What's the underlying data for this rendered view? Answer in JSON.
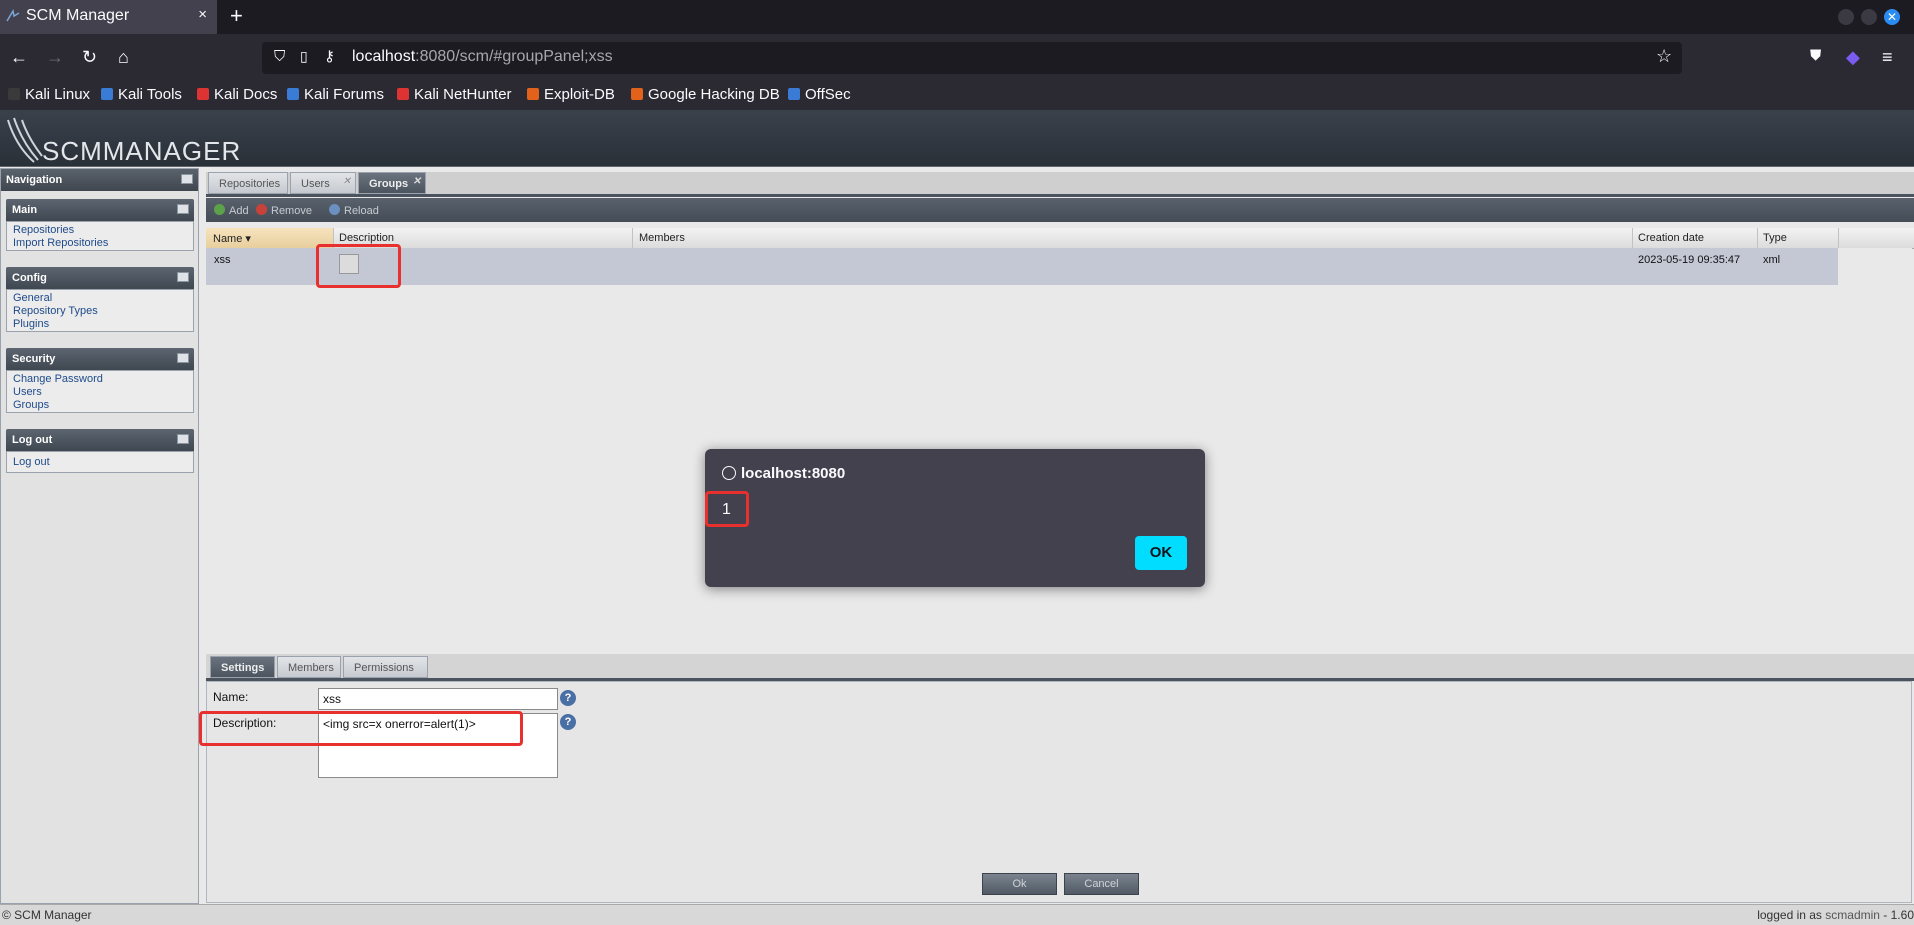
{
  "browser": {
    "tab_title": "SCM Manager",
    "tab_close": "×",
    "new_tab": "+",
    "url_host": "localhost",
    "url_rest": ":8080/scm/#groupPanel;xss",
    "bookmarks": [
      "Kali Linux",
      "Kali Tools",
      "Kali Docs",
      "Kali Forums",
      "Kali NetHunter",
      "Exploit-DB",
      "Google Hacking DB",
      "OffSec"
    ]
  },
  "app": {
    "logo": "SCMMANAGER",
    "nav_title": "Navigation",
    "panels": [
      {
        "title": "Main",
        "links": [
          "Repositories",
          "Import Repositories"
        ]
      },
      {
        "title": "Config",
        "links": [
          "General",
          "Repository Types",
          "Plugins"
        ]
      },
      {
        "title": "Security",
        "links": [
          "Change Password",
          "Users",
          "Groups"
        ]
      },
      {
        "title": "Log out",
        "links": [
          "Log out"
        ]
      }
    ],
    "tabs": [
      "Repositories",
      "Users",
      "Groups"
    ],
    "toolbar": {
      "add": "Add",
      "remove": "Remove",
      "reload": "Reload"
    },
    "grid": {
      "columns": [
        "Name",
        "Description",
        "Members",
        "Creation date",
        "Type"
      ],
      "rows": [
        {
          "name": "xss",
          "description": "",
          "members": "",
          "created": "2023-05-19 09:35:47",
          "type": "xml"
        }
      ]
    },
    "detail_tabs": [
      "Settings",
      "Members",
      "Permissions"
    ],
    "form": {
      "name_label": "Name:",
      "name_value": "xss",
      "description_label": "Description:",
      "description_value": "<img src=x onerror=alert(1)>",
      "ok": "Ok",
      "cancel": "Cancel"
    },
    "status": {
      "left": "© SCM Manager",
      "right_prefix": "logged in as ",
      "user": "scmadmin",
      "version": " - 1.60"
    }
  },
  "dialog": {
    "origin": "localhost:8080",
    "message": "1",
    "ok": "OK"
  },
  "colors": {
    "accent": "#00ddff",
    "highlight": "#e8312e",
    "selected_row": "#c3c8d4"
  }
}
